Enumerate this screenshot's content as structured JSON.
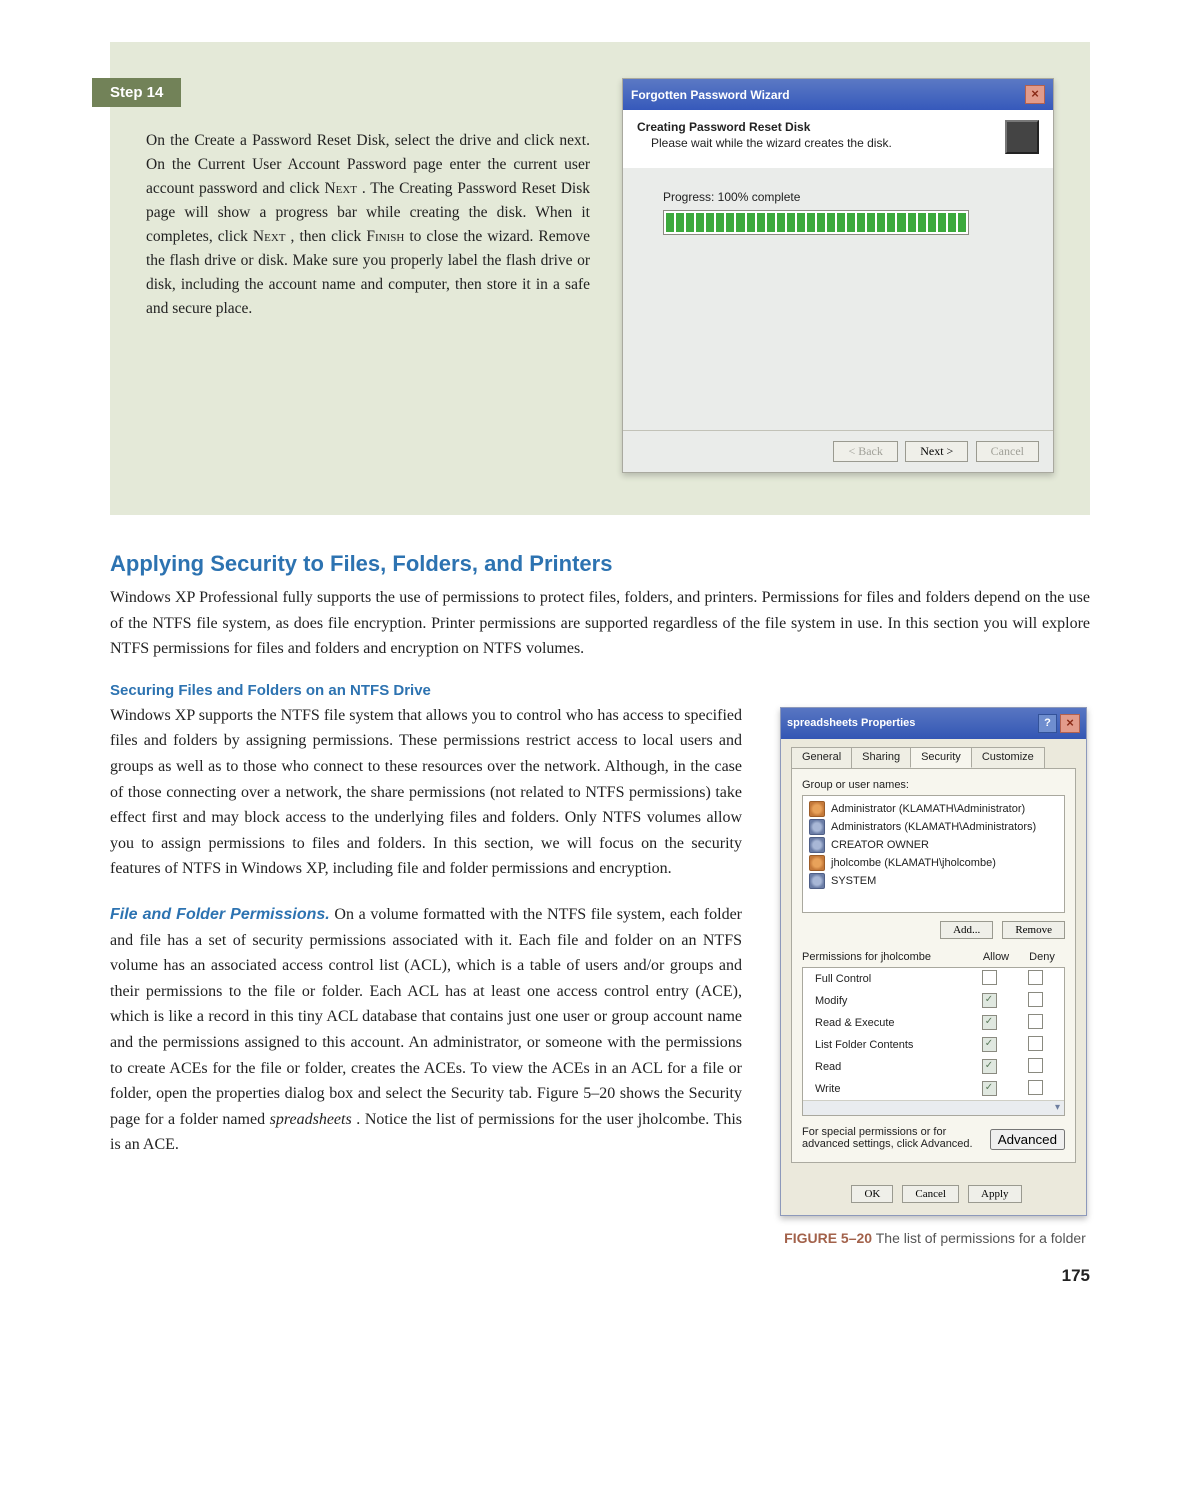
{
  "step14": {
    "header": "Step 14",
    "body_1": "On the Create a Password Reset Disk, select the drive and click next. On the Current User Account Password page enter the current user account password and click ",
    "body_next": "Next",
    "body_2": ". The Creating Password Reset Disk page will show a progress bar while creating the disk. When it completes, click ",
    "body_3": ", then click ",
    "body_finish": "Finish",
    "body_4": " to close the wizard. Remove the flash drive or disk. Make sure you properly label the flash drive or disk, including the account name and computer, then store it in a safe and secure place."
  },
  "wizard": {
    "title": "Forgotten Password Wizard",
    "sub_title": "Creating Password Reset Disk",
    "sub_msg": "Please wait while the wizard creates the disk.",
    "progress_label": "Progress: 100% complete",
    "btn_back": "< Back",
    "btn_next": "Next >",
    "btn_cancel": "Cancel"
  },
  "sec_heading": "Applying Security to Files, Folders, and Printers",
  "sec_para": "Windows XP Professional fully supports the use of permissions to protect files, folders, and printers. Permissions for files and folders depend on the use of the NTFS file system, as does file encryption. Printer permissions are supported regardless of the file system in use. In this section you will explore NTFS permissions for files and folders and encryption on NTFS volumes.",
  "sub_heading": "Securing Files and Folders on an NTFS Drive",
  "sub_para": "Windows XP supports the NTFS file system that allows you to control who has access to specified files and folders by assigning permissions. These permissions restrict access to local users and groups as well as to those who connect to these resources over the network. Although, in the case of those connecting over a network, the share permissions (not related to NTFS permissions) take effect first and may block access to the underlying files and folders. Only NTFS volumes allow you to assign permissions to files and folders. In this section, we will focus on the security features of NTFS in Windows XP, including file and folder permissions and encryption.",
  "ffp_lead": "File and Folder Permissions.",
  "ffp_body_a": " On a volume formatted with the NTFS file system, each folder and file has a set of security permissions associated with it. Each file and folder on an NTFS volume has an associated access control list (ACL), which is a table of users and/or groups and their permissions to the file or folder. Each ACL has at least one access control entry (ACE), which is like a record in this tiny ACL database that contains just one user or group account name and the permissions assigned to this account. An administrator, or someone with the permissions to create ACEs for the file or folder, creates the ACEs. To view the ACEs in an ACL for a file or folder, open the properties dialog box and select the Security tab. Figure 5–20 shows the Security page for a folder named ",
  "ffp_em": "spreadsheets",
  "ffp_body_b": ". Notice the list of permissions for the user jholcombe. This is an ACE.",
  "props": {
    "title": "spreadsheets Properties",
    "tabs": [
      "General",
      "Sharing",
      "Security",
      "Customize"
    ],
    "group_label": "Group or user names:",
    "principals": [
      {
        "kind": "u",
        "label": "Administrator (KLAMATH\\Administrator)"
      },
      {
        "kind": "g",
        "label": "Administrators (KLAMATH\\Administrators)"
      },
      {
        "kind": "g",
        "label": "CREATOR OWNER"
      },
      {
        "kind": "u",
        "label": "jholcombe (KLAMATH\\jholcombe)"
      },
      {
        "kind": "g",
        "label": "SYSTEM"
      }
    ],
    "btn_add": "Add...",
    "btn_remove": "Remove",
    "perm_for": "Permissions for jholcombe",
    "col_allow": "Allow",
    "col_deny": "Deny",
    "perms": [
      {
        "name": "Full Control",
        "allow": false,
        "deny": false
      },
      {
        "name": "Modify",
        "allow": true,
        "deny": false
      },
      {
        "name": "Read & Execute",
        "allow": true,
        "deny": false
      },
      {
        "name": "List Folder Contents",
        "allow": true,
        "deny": false
      },
      {
        "name": "Read",
        "allow": true,
        "deny": false
      },
      {
        "name": "Write",
        "allow": true,
        "deny": false
      }
    ],
    "adv_text": "For special permissions or for advanced settings, click Advanced.",
    "btn_adv": "Advanced",
    "btn_ok": "OK",
    "btn_cancel": "Cancel",
    "btn_apply": "Apply"
  },
  "fig_caption_lead": "FIGURE 5–20",
  "fig_caption_rest": " The list of permissions for a folder",
  "page_number": "175"
}
